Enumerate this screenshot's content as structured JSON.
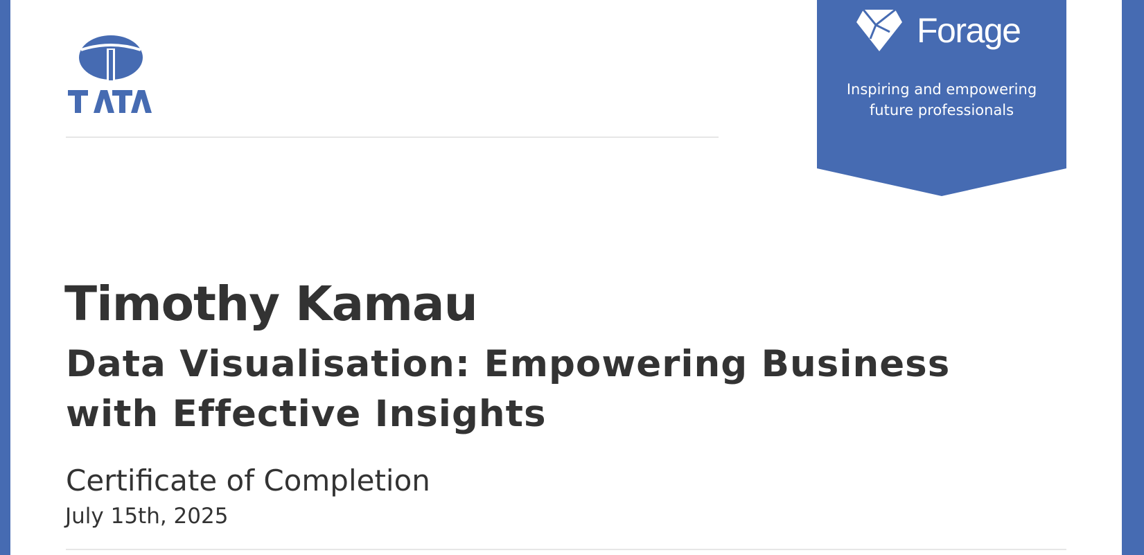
{
  "issuer": {
    "logo_text": "TATA",
    "logo_icon": "tata-t-emblem-icon"
  },
  "platform": {
    "name": "Forage",
    "logo_icon": "forage-diamond-icon",
    "tagline_line1": "Inspiring and empowering",
    "tagline_line2": "future professionals"
  },
  "certificate": {
    "recipient": "Timothy Kamau",
    "course_title": "Data Visualisation: Empowering Business with Effective Insights",
    "type": "Certificate of Completion",
    "date": "July 15th, 2025"
  },
  "colors": {
    "brand_blue": "#466bb2",
    "text_dark": "#333333",
    "rule_gray": "#e6e6e6",
    "background": "#ffffff"
  }
}
